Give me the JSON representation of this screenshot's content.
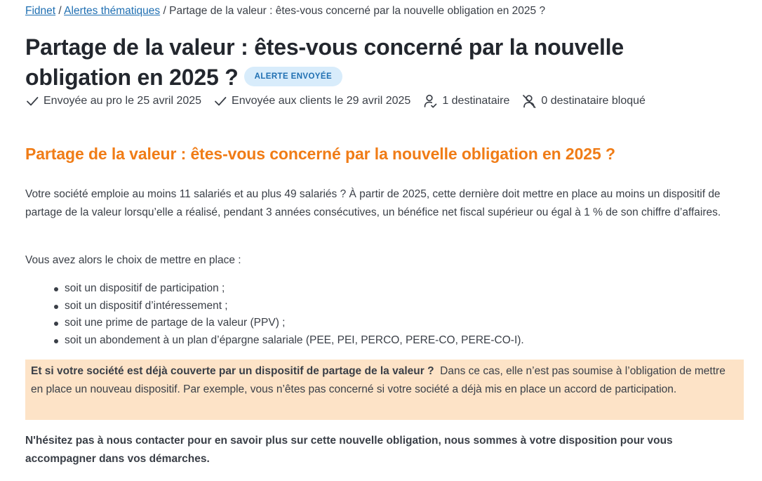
{
  "breadcrumb": {
    "items": [
      "Fidnet",
      "Alertes thématiques"
    ],
    "separator": "/",
    "current": "Partage de la valeur : êtes-vous concerné par la nouvelle obligation en 2025 ?"
  },
  "header": {
    "title": "Partage de la valeur : êtes-vous concerné par la nouvelle obligation en 2025 ?",
    "badge": "ALERTE ENVOYÉE"
  },
  "meta": {
    "sent_pro": "Envoyée au pro le 25 avril 2025",
    "sent_clients": "Envoyée aux clients le 29 avril 2025",
    "recipients": "1 destinataire",
    "blocked": "0 destinataire bloqué",
    "icons": [
      "check-icon",
      "check-icon",
      "user-check-icon",
      "user-blocked-icon"
    ]
  },
  "content": {
    "heading": "Partage de la valeur : êtes-vous concerné par la nouvelle obligation en 2025 ?",
    "paragraph1": "Votre société emploie au moins 11 salariés et au plus 49 salariés ? À partir de 2025, cette dernière doit mettre en place au moins un dispositif de partage de la valeur lorsqu’elle a réalisé, pendant 3 années consécutives, un bénéfice net fiscal supérieur ou égal à 1 % de son chiffre d’affaires.",
    "paragraph2": "Vous avez alors le choix de mettre en place :",
    "bullets": [
      "soit un dispositif de participation ;",
      "soit un dispositif d’intéressement ;",
      "soit une prime de partage de la valeur (PPV) ;",
      "soit un abondement à un plan d’épargne salariale (PEE, PEI, PERCO, PERE-CO, PERE-CO-I)."
    ],
    "callout_bold": "Et si votre société est déjà couverte par un dispositif de partage de la valeur ?",
    "callout_text": "Dans ce cas, elle n’est pas soumise à l’obligation de mettre en place un nouveau dispositif. Par exemple, vous n’êtes pas concerné si votre société a déjà mis en place un accord de participation.",
    "closing": "N'hésitez pas à nous contacter pour en savoir plus sur cette nouvelle obligation, nous sommes à votre disposition pour vous accompagner dans vos démarches."
  },
  "colors": {
    "link": "#1f6fb2",
    "heading_accent": "#f07c16",
    "badge_bg": "#d8ecfb",
    "callout_bg": "#fde3c7",
    "text": "#3a3f47"
  }
}
